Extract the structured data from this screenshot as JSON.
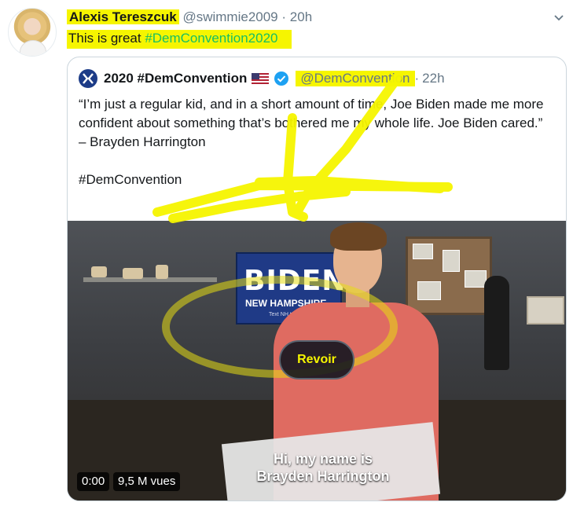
{
  "tweet": {
    "author": {
      "display_name": "Alexis Tereszcuk",
      "handle": "@swimmie2009",
      "separator": "·",
      "time": "20h"
    },
    "text_prefix": "This is great ",
    "hashtag": "#DemConvention2020"
  },
  "quote": {
    "account_name": "2020 #DemConvention",
    "handle": "@DemConvention",
    "separator": "·",
    "time": "22h",
    "body": "“I’m just a regular kid, and in a short amount of time, Joe Biden made me more confident about something that’s bothered me my whole life. Joe Biden cared.”\n– Brayden Harrington",
    "hashtag": "#DemConvention"
  },
  "video": {
    "sign_main": "BIDEN",
    "sign_state": "NEW HAMPSHIRE",
    "sign_text": "Text NH to 30330",
    "replay_label": "Revoir",
    "caption_line1": "Hi, my name is",
    "caption_line2": "Brayden Harrington",
    "timestamp": "0:00",
    "views": "9,5 M vues"
  },
  "colors": {
    "highlight": "#f6f500",
    "hashtag": "#17bf63",
    "verified": "#1da1f2",
    "border": "#ccd6dd"
  },
  "icons": [
    "chevron-down-icon",
    "verified-badge-icon",
    "us-flag-icon",
    "convention-logo-icon"
  ]
}
